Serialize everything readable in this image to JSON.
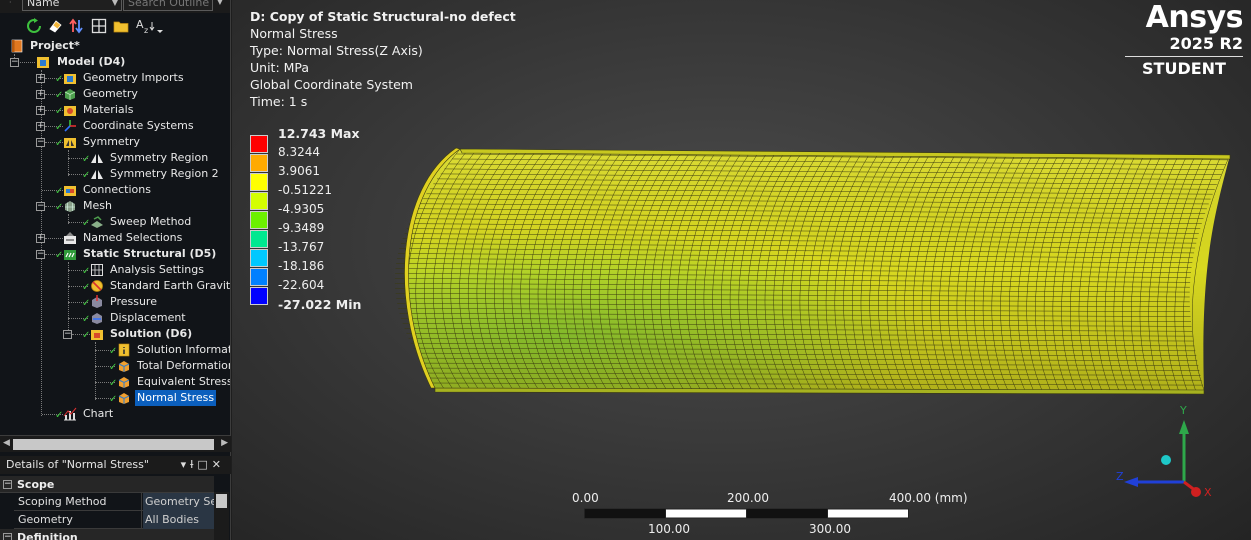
{
  "outline": {
    "name_combo": "Name",
    "search_placeholder": "Search Outline",
    "tree": [
      {
        "label": "Project*",
        "icon": "project-icon"
      },
      {
        "label": "Model (D4)",
        "icon": "model-icon"
      },
      {
        "label": "Geometry Imports",
        "icon": "geometry-imports-icon"
      },
      {
        "label": "Geometry",
        "icon": "geometry-icon"
      },
      {
        "label": "Materials",
        "icon": "materials-icon"
      },
      {
        "label": "Coordinate Systems",
        "icon": "coordinate-systems-icon"
      },
      {
        "label": "Symmetry",
        "icon": "symmetry-icon"
      },
      {
        "label": "Symmetry Region",
        "icon": "symmetry-region-icon"
      },
      {
        "label": "Symmetry Region 2",
        "icon": "symmetry-region-icon"
      },
      {
        "label": "Connections",
        "icon": "connections-icon"
      },
      {
        "label": "Mesh",
        "icon": "mesh-icon"
      },
      {
        "label": "Sweep Method",
        "icon": "sweep-method-icon"
      },
      {
        "label": "Named Selections",
        "icon": "named-selections-icon"
      },
      {
        "label": "Static Structural (D5)",
        "icon": "static-structural-icon"
      },
      {
        "label": "Analysis Settings",
        "icon": "analysis-settings-icon"
      },
      {
        "label": "Standard Earth Gravity",
        "icon": "gravity-icon"
      },
      {
        "label": "Pressure",
        "icon": "pressure-icon"
      },
      {
        "label": "Displacement",
        "icon": "displacement-icon"
      },
      {
        "label": "Solution (D6)",
        "icon": "solution-icon"
      },
      {
        "label": "Solution Information",
        "icon": "solution-information-icon"
      },
      {
        "label": "Total Deformation",
        "icon": "result-icon"
      },
      {
        "label": "Equivalent Stress",
        "icon": "result-icon"
      },
      {
        "label": "Normal Stress",
        "icon": "result-icon"
      },
      {
        "label": "Chart",
        "icon": "chart-icon"
      }
    ]
  },
  "details": {
    "title": "Details of \"Normal Stress\"",
    "groups": [
      {
        "label": "Scope"
      },
      {
        "label": "Definition"
      }
    ],
    "properties": [
      {
        "key": "Scoping Method",
        "value": "Geometry Selection"
      },
      {
        "key": "Geometry",
        "value": "All Bodies"
      }
    ]
  },
  "result_info": {
    "title": "D: Copy of Static Structural-no defect",
    "result_type": "Normal Stress",
    "type_line": "Type: Normal Stress(Z Axis)",
    "unit_line": "Unit: MPa",
    "coord_line": "Global Coordinate System",
    "time_line": "Time: 1 s"
  },
  "legend": {
    "max_label": "12.743 Max",
    "min_label": "-27.022 Min",
    "values": [
      "8.3244",
      "3.9061",
      "-0.51221",
      "-4.9305",
      "-9.3489",
      "-13.767",
      "-18.186",
      "-22.604"
    ],
    "colors": [
      "#ff0000",
      "#ffaa00",
      "#ffff00",
      "#d4ff00",
      "#6cf000",
      "#00e890",
      "#00c8ff",
      "#0080ff",
      "#0000ff"
    ]
  },
  "logo": {
    "brand": "Ansys",
    "version": "2025 R2",
    "edition": "STUDENT"
  },
  "scale_bar": {
    "top_labels": [
      "0.00",
      "200.00",
      "400.00 (mm)"
    ],
    "bottom_labels": [
      "100.00",
      "300.00"
    ]
  },
  "triad": {
    "x_label": "X",
    "y_label": "Y",
    "z_label": "Z"
  },
  "colors": {
    "selection": "#0b5fbd",
    "check": "#3ec13e",
    "mesh_yellow": "#d8d820",
    "mesh_green": "#8ccc30"
  }
}
